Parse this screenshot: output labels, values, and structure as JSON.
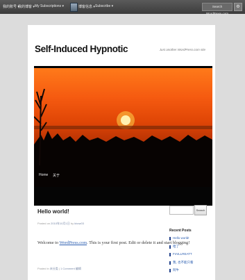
{
  "admin_bar": {
    "items": [
      "我的账号 ▾",
      "我的博客 ▾",
      "My Subscriptions ▾",
      "博客信息 ▾",
      "Subscribe ▾"
    ],
    "search_link": "Search WordPress.com"
  },
  "site": {
    "title": "Self-Induced Hypnotic",
    "description": "Just another WordPress.com site"
  },
  "nav": {
    "home": "Home",
    "about": "关于"
  },
  "post": {
    "title": "Hello world!",
    "meta_prefix": "Posted on",
    "meta_date": "2010年10月1日",
    "meta_by": "by",
    "meta_author": "kbow03",
    "body_prefix": "Welcome to",
    "body_link": "WordPress.com",
    "body_suffix": ". This is your first post. Edit or delete it and start blogging!",
    "footer_prefix": "Posted in",
    "footer_category": "未分类",
    "footer_sep": " | ",
    "footer_comments": "1 Comment",
    "footer_edit": "编辑"
  },
  "sidebar": {
    "search_button": "Search",
    "recent_title": "Recent Posts",
    "recent_posts": [
      "Hello world!",
      "哈了",
      "FIAILLREATT",
      "我, 也不能只看",
      "阿牛"
    ]
  }
}
